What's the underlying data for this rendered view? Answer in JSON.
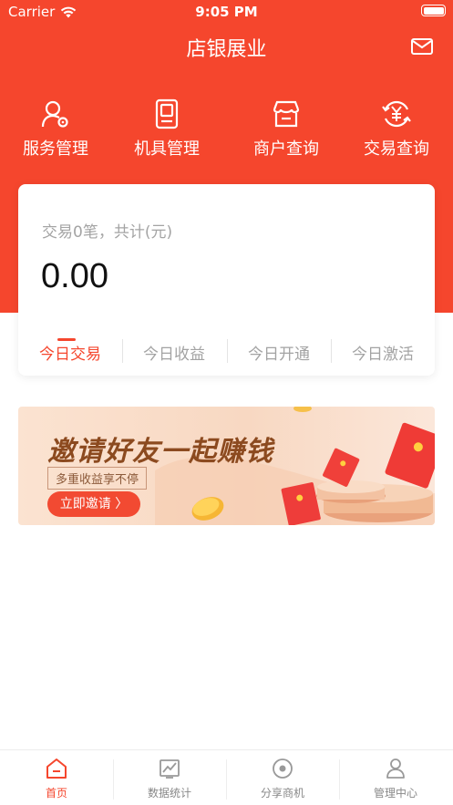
{
  "status_bar": {
    "carrier": "Carrier",
    "time": "9:05 PM"
  },
  "header": {
    "title": "店银展业",
    "mail_icon": "mail-icon"
  },
  "quick_menu": [
    {
      "label": "服务管理",
      "icon": "user-settings-icon"
    },
    {
      "label": "机具管理",
      "icon": "device-icon"
    },
    {
      "label": "商户查询",
      "icon": "store-icon"
    },
    {
      "label": "交易查询",
      "icon": "yuan-exchange-icon"
    }
  ],
  "summary": {
    "text": "交易0笔，共计(元)",
    "amount": "0.00",
    "tabs": [
      "今日交易",
      "今日收益",
      "今日开通",
      "今日激活"
    ],
    "active_tab": 0
  },
  "banner": {
    "title": "邀请好友一起赚钱",
    "subtitle": "多重收益享不停",
    "button": "立即邀请 〉"
  },
  "tabbar": {
    "items": [
      {
        "label": "首页",
        "icon": "home-icon"
      },
      {
        "label": "数据统计",
        "icon": "chart-icon"
      },
      {
        "label": "分享商机",
        "icon": "share-icon"
      },
      {
        "label": "管理中心",
        "icon": "profile-icon"
      }
    ],
    "active": 0
  },
  "colors": {
    "brand": "#f5462d",
    "muted": "#a4a4a4"
  }
}
